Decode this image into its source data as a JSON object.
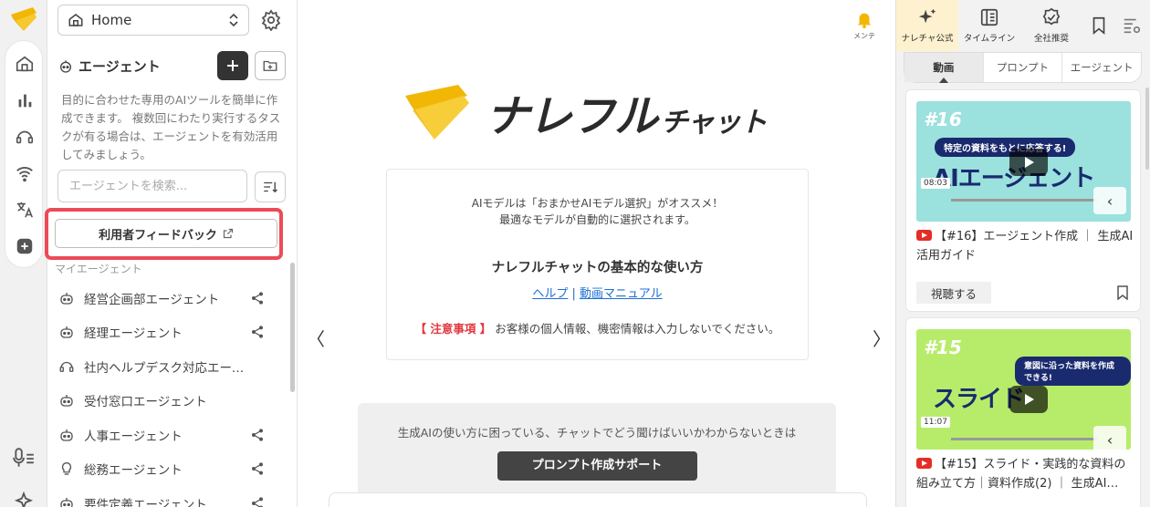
{
  "sidebar": {
    "home_label": "Home",
    "agent_title": "エージェント",
    "description": "目的に合わせた専用のAIツールを簡単に作成できます。 複数回にわたり実行するタスクが有る場合は、エージェントを有効活用してみましょう。",
    "search_placeholder": "エージェントを検索...",
    "feedback_label": "利用者フィードバック",
    "section_label": "マイエージェント",
    "agents": [
      {
        "name": "経営企画部エージェント",
        "shared": true
      },
      {
        "name": "経理エージェント",
        "shared": true
      },
      {
        "name": "社内ヘルプデスク対応エージェント",
        "shared": false
      },
      {
        "name": "受付窓口エージェント",
        "shared": false
      },
      {
        "name": "人事エージェント",
        "shared": true
      },
      {
        "name": "総務エージェント",
        "shared": true
      },
      {
        "name": "要件定義エージェント",
        "shared": true
      }
    ]
  },
  "main": {
    "bell_label": "メンテ",
    "logo_main": "ナレフル",
    "logo_sub": "チャット",
    "info_line1": "AIモデルは「おまかせAIモデル選択」がオススメ！",
    "info_line2": "最適なモデルが自動的に選択されます。",
    "info_heading": "ナレフルチャットの基本的な使い方",
    "link_help": "ヘルプ",
    "link_sep": "|",
    "link_manual": "動画マニュアル",
    "notice_tag": "【 注意事項 】",
    "notice_text": "お客様の個人情報、機密情報は入力しないでください。",
    "arrow_left": "〈",
    "arrow_right": "〉",
    "help_text": "生成AIの使い方に困っている、チャットでどう聞けばいいかわからないときは",
    "help_button": "プロンプト作成サポート"
  },
  "right": {
    "tabs": [
      "ナレチャ公式",
      "タイムライン",
      "全社推奨"
    ],
    "subtabs": [
      "動画",
      "プロンプト",
      "エージェント"
    ],
    "videos": [
      {
        "badge": "#16",
        "headline": "特定の資料をもとに応答する!",
        "big": "AIエージェント",
        "duration": "08:03",
        "title": "【#16】エージェント作成 ｜ 生成AI活用ガイド",
        "watch": "視聴する"
      },
      {
        "badge": "#15",
        "headline": "意図に沿った資料を作成できる!",
        "big": "スライド",
        "duration": "11:07",
        "title": "【#15】スライド・実践的な資料の組み立て方｜資料作成(2) ｜ 生成AI…"
      }
    ],
    "colors": {
      "video1": "#9be1dd",
      "video2": "#b7ec6b"
    }
  }
}
